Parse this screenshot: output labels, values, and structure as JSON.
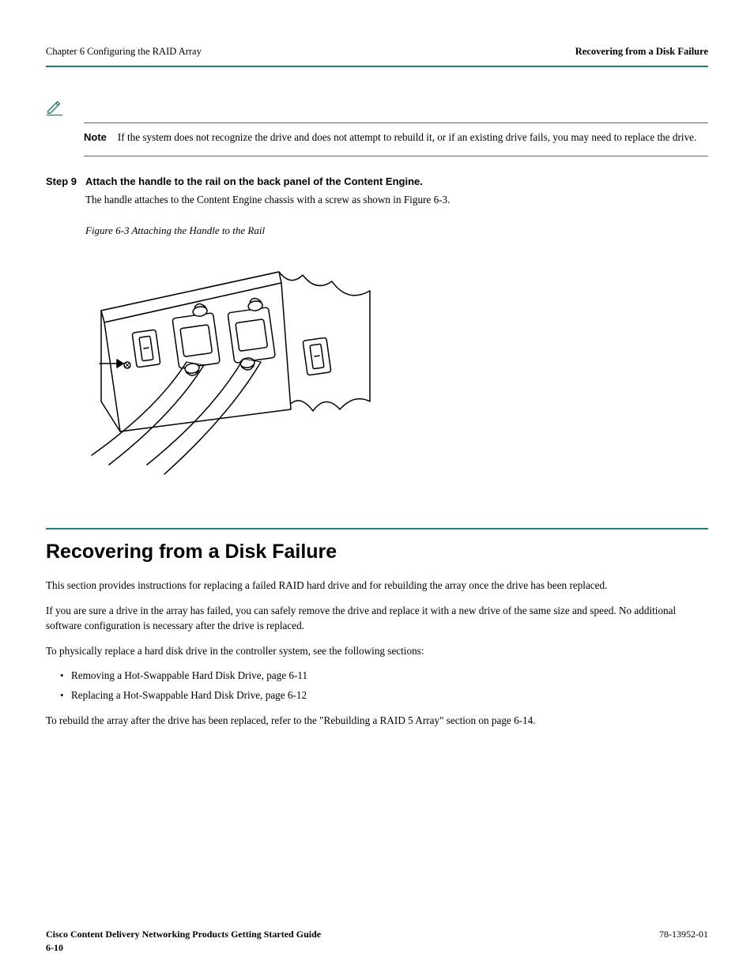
{
  "header": {
    "chapter": "Chapter 6      Configuring the RAID Array",
    "section": "Recovering from a Disk Failure"
  },
  "note": {
    "label": "Note",
    "body": "If the system does not recognize the drive and does not attempt to rebuild it, or if an existing drive fails, you may need to replace the drive."
  },
  "step": {
    "number": "Step 9",
    "text": "Attach the handle to the rail on the back panel of the Content Engine.",
    "sub": "The handle attaches to the Content Engine chassis with a screw as shown in Figure 6-3.",
    "figure_caption": "Figure 6-3    Attaching the Handle to the Rail"
  },
  "section": {
    "title": "Recovering from a Disk Failure",
    "p1": "This section provides instructions for replacing a failed RAID hard drive and for rebuilding the array once the drive has been replaced.",
    "p2": "If you are sure a drive in the array has failed, you can safely remove the drive and replace it with a new drive of the same size and speed. No additional software configuration is necessary after the drive is replaced.",
    "p3": "To physically replace a hard disk drive in the controller system, see the following sections:",
    "p4_prefix": "To rebuild the array after the drive has been replaced, refer to the ",
    "p4_link": "\"Rebuilding a RAID 5 Array\" section on page 6-14",
    "p4_suffix": "."
  },
  "bullets": [
    "Removing a Hot-Swappable Hard Disk Drive, page 6-11",
    "Replacing a Hot-Swappable Hard Disk Drive, page 6-12"
  ],
  "footer": {
    "title": "Cisco Content Delivery Networking Products Getting Started Guide",
    "docnum": "78-13952-01",
    "page": "6-10"
  }
}
